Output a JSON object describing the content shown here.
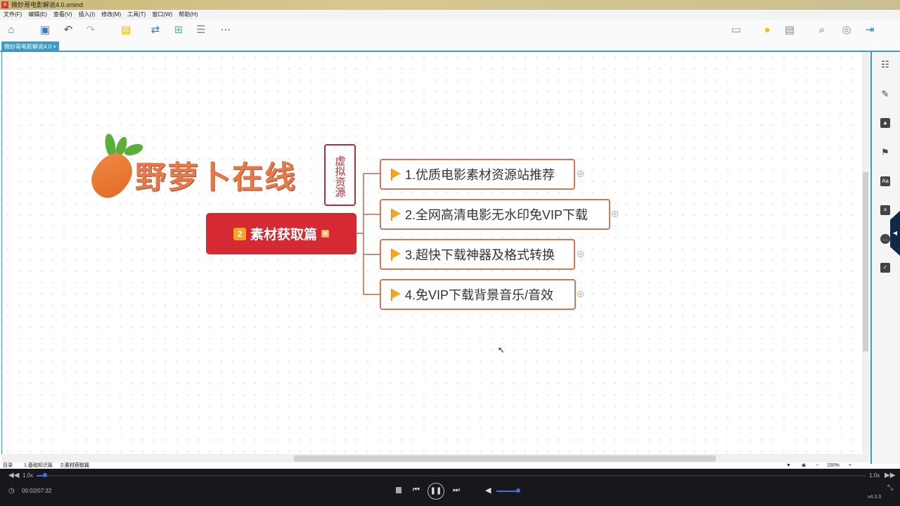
{
  "window": {
    "title": "微妙哥电影解说4.0.xmind"
  },
  "menu": [
    "文件(F)",
    "编辑(E)",
    "查看(V)",
    "插入(I)",
    "修改(M)",
    "工具(T)",
    "窗口(W)",
    "帮助(H)"
  ],
  "tab": {
    "label": "微妙哥电影解说4.0",
    "close": "×"
  },
  "logo": {
    "text": "野萝卜在线",
    "stamp": "虚拟资源"
  },
  "central": {
    "number": "2",
    "label": "素材获取篇",
    "marker": "M"
  },
  "topics": [
    {
      "label": "1.优质电影素材资源站推荐"
    },
    {
      "label": "2.全网高清电影无水印免VIP下载"
    },
    {
      "label": "3.超快下载神器及格式转换"
    },
    {
      "label": "4.免VIP下载背景音乐/音效"
    }
  ],
  "sheets": [
    "目录",
    "1.基础知识篇",
    "2.素材获取篇"
  ],
  "zoom_level": "150%",
  "player": {
    "speed_left": "1.0x",
    "speed_right": "1.0x",
    "time": "00:02/07:32",
    "version": "v4.3.3",
    "progress": 0.004,
    "volume": 0.8
  },
  "colors": {
    "accent": "#3a9cc4",
    "central": "#d52a33",
    "topic_border": "#c9785c"
  }
}
